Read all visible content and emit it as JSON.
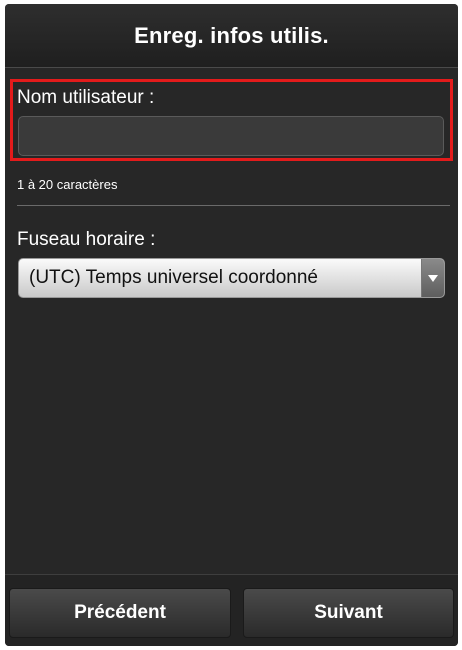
{
  "header": {
    "title": "Enreg. infos utilis."
  },
  "username": {
    "label": "Nom utilisateur :",
    "value": "",
    "placeholder": "",
    "hint": "1 à 20 caractères"
  },
  "timezone": {
    "label": "Fuseau horaire :",
    "selected": "(UTC) Temps universel coordonné",
    "icon": "chevron-down-icon"
  },
  "footer": {
    "prev_label": "Précédent",
    "next_label": "Suivant"
  },
  "colors": {
    "highlight": "#e31b1b",
    "background": "#272727"
  }
}
